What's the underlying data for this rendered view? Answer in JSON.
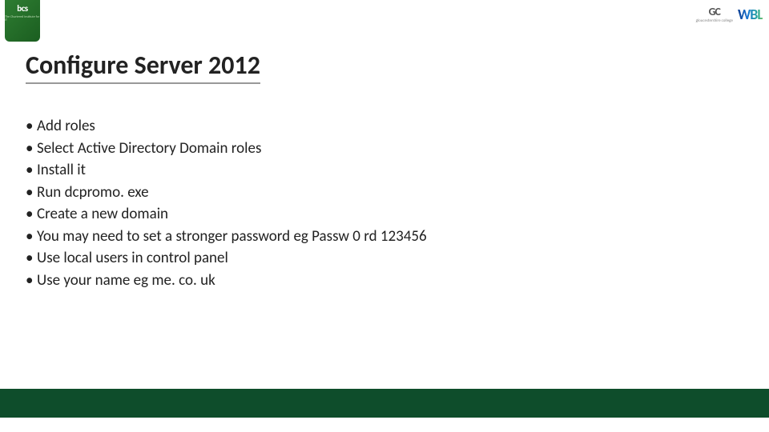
{
  "logos": {
    "bcs": {
      "main": "bcs",
      "sub": "The Chartered Institute for IT"
    },
    "gc": {
      "main": "GC",
      "sub": "gloucestershire college"
    },
    "wbl": {
      "text": "WBL"
    }
  },
  "title": "Configure Server 2012",
  "bullets": [
    "Add roles",
    "Select Active Directory Domain roles",
    "Install it",
    "Run dcpromo. exe",
    "Create a new domain",
    "You may need to set a stronger password eg Passw 0 rd 123456",
    "Use local users in control panel",
    "Use your name eg me. co. uk"
  ]
}
